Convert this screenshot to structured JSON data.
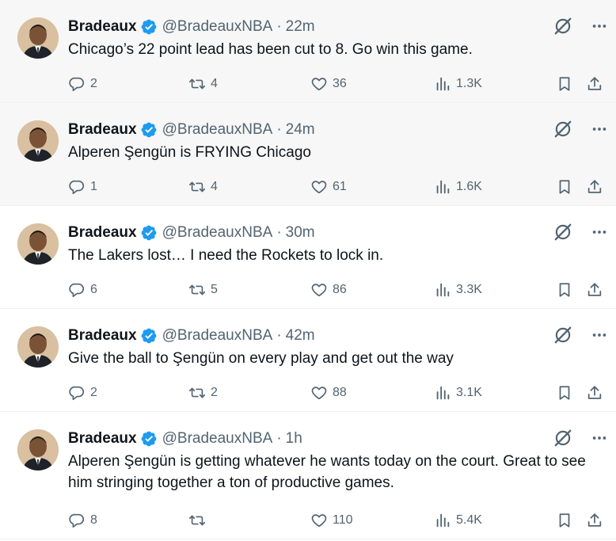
{
  "tweets": [
    {
      "name": "Bradeaux",
      "handle": "@BradeauxNBA",
      "separator": "·",
      "time": "22m",
      "text": "Chicago’s 22 point lead has been cut to 8. Go win this game.",
      "replies": "2",
      "retweets": "4",
      "likes": "36",
      "views": "1.3K"
    },
    {
      "name": "Bradeaux",
      "handle": "@BradeauxNBA",
      "separator": "·",
      "time": "24m",
      "text": "Alperen Şengün is FRYING Chicago",
      "replies": "1",
      "retweets": "4",
      "likes": "61",
      "views": "1.6K"
    },
    {
      "name": "Bradeaux",
      "handle": "@BradeauxNBA",
      "separator": "·",
      "time": "30m",
      "text": "The Lakers lost… I need the Rockets to lock in.",
      "replies": "6",
      "retweets": "5",
      "likes": "86",
      "views": "3.3K"
    },
    {
      "name": "Bradeaux",
      "handle": "@BradeauxNBA",
      "separator": "·",
      "time": "42m",
      "text": "Give the ball to Şengün on every play and get out the way",
      "replies": "2",
      "retweets": "2",
      "likes": "88",
      "views": "3.1K"
    },
    {
      "name": "Bradeaux",
      "handle": "@BradeauxNBA",
      "separator": "·",
      "time": "1h",
      "text": "Alperen Şengün is getting whatever he wants today on the court. Great to see him stringing together a ton of productive games.",
      "replies": "8",
      "retweets": "",
      "likes": "110",
      "views": "5.4K"
    }
  ],
  "colors": {
    "verified": "#1d9bf0",
    "icon": "#536471",
    "text": "#0f1419",
    "hover_bg": "#f7f7f7",
    "divider": "#eff3f4"
  },
  "icons": [
    "reply-icon",
    "retweet-icon",
    "like-icon",
    "views-icon",
    "bookmark-icon",
    "share-icon",
    "grok-icon",
    "more-icon",
    "verified-badge-icon"
  ]
}
